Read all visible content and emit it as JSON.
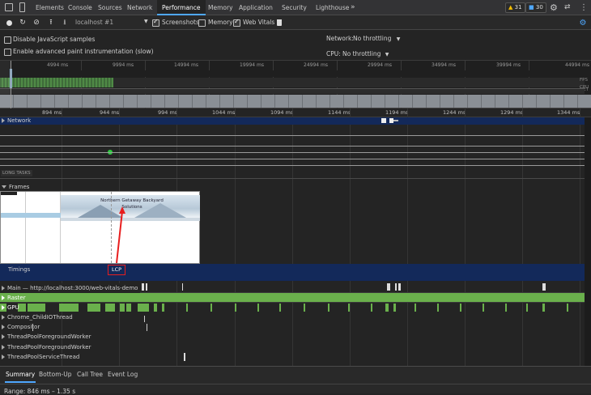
{
  "tabs": [
    "Elements",
    "Console",
    "Sources",
    "Network",
    "Performance",
    "Memory",
    "Application",
    "Security",
    "Lighthouse"
  ],
  "active_tab": "Performance",
  "badges": {
    "warnings": "31",
    "messages": "30"
  },
  "toolbar": {
    "profile": "localhost #1",
    "screenshots_label": "Screenshots",
    "memory_label": "Memory",
    "webvitals_label": "Web Vitals"
  },
  "settings": {
    "disable_js_samples": "Disable JavaScript samples",
    "advanced_paint": "Enable advanced paint instrumentation (slow)",
    "network_label": "Network:",
    "network_value": "No throttling",
    "cpu_label": "CPU:",
    "cpu_value": "No throttling"
  },
  "overview": {
    "ticks": [
      "4994 ms",
      "9994 ms",
      "14994 ms",
      "19994 ms",
      "24994 ms",
      "29994 ms",
      "34994 ms",
      "39994 ms",
      "44994 ms"
    ],
    "labels": [
      "FPS",
      "CPU",
      "NET"
    ]
  },
  "ruler": [
    "894 ms",
    "944 ms",
    "994 ms",
    "1044 ms",
    "1094 ms",
    "1144 ms",
    "1194 ms",
    "1244 ms",
    "1294 ms",
    "1344 ms"
  ],
  "tracks": {
    "network": "Network",
    "long_tasks": "LONG TASKS",
    "frames": "Frames",
    "timings": "Timings",
    "lcp": "LCP",
    "main": "Main — http://localhost:3000/web-vitals-demo",
    "raster": "Raster",
    "gpu": "GPU",
    "chrome_io": "Chrome_ChildIOThread",
    "compositor": "Compositor",
    "pool1": "ThreadPoolForegroundWorker",
    "pool2": "ThreadPoolForegroundWorker",
    "pool3": "ThreadPoolServiceThread"
  },
  "screenshot": {
    "title": "Northern Getaway Backyard\nSolutions"
  },
  "bottom_tabs": [
    "Summary",
    "Bottom-Up",
    "Call Tree",
    "Event Log"
  ],
  "range": "Range: 846 ms – 1.35 s"
}
